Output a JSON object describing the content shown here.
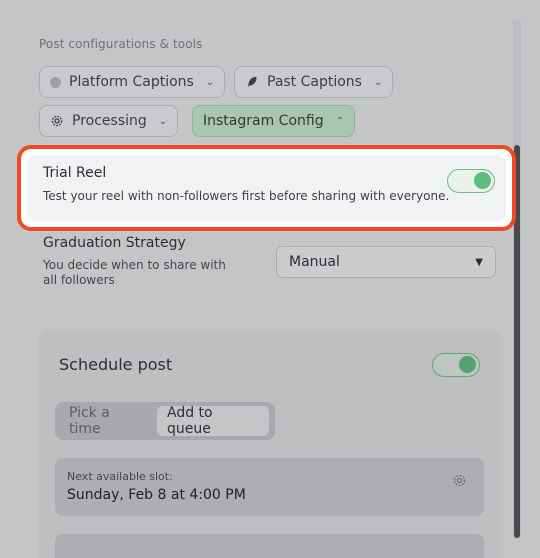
{
  "section_label": "Post configurations & tools",
  "chips": {
    "platform_captions": "Platform Captions",
    "past_captions": "Past Captions",
    "processing": "Processing",
    "instagram_config": "Instagram Config"
  },
  "trial_reel": {
    "title": "Trial Reel",
    "description": "Test your reel with non-followers first before sharing with everyone.",
    "enabled": true
  },
  "graduation": {
    "title": "Graduation Strategy",
    "description": "You decide when to share with all followers",
    "selected": "Manual"
  },
  "schedule": {
    "title": "Schedule post",
    "enabled": true,
    "options": [
      "Pick a time",
      "Add to queue"
    ],
    "selected_option": "Add to queue",
    "slot_label": "Next available slot:",
    "slot_value": "Sunday, Feb 8 at 4:00 PM"
  },
  "colors": {
    "highlight_border": "#f04a23",
    "toggle_on": "#5fbd7d",
    "active_chip": "#a9c6b2"
  }
}
